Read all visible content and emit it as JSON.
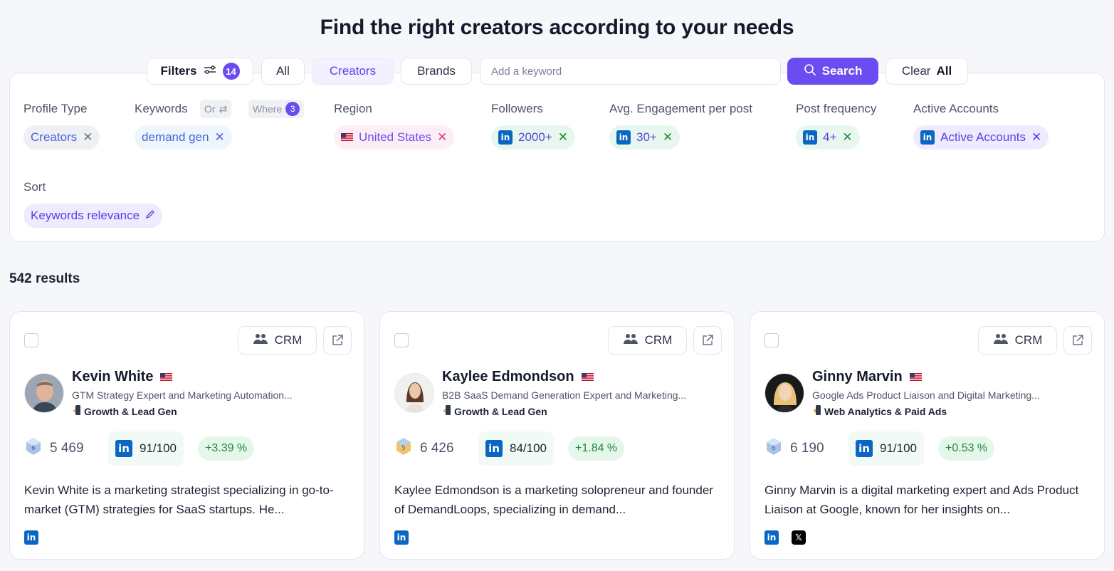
{
  "page": {
    "title": "Find the right creators according to your needs"
  },
  "toolbar": {
    "filters_label": "Filters",
    "filters_count": "14",
    "all_label": "All",
    "creators_label": "Creators",
    "brands_label": "Brands",
    "keyword_placeholder": "Add a keyword",
    "search_label": "Search",
    "clear_label": "Clear",
    "clear_all_label": "All"
  },
  "filters": {
    "profile_type": {
      "label": "Profile Type",
      "chip": "Creators"
    },
    "keywords": {
      "label": "Keywords",
      "or_label": "Or",
      "where_label": "Where",
      "where_count": "3",
      "chip": "demand gen"
    },
    "region": {
      "label": "Region",
      "chip": "United States"
    },
    "followers": {
      "label": "Followers",
      "chip": "2000+"
    },
    "engagement": {
      "label": "Avg. Engagement per post",
      "chip": "30+"
    },
    "post_frequency": {
      "label": "Post frequency",
      "chip": "4+"
    },
    "active_accounts": {
      "label": "Active Accounts",
      "chip": "Active Accounts"
    },
    "sort": {
      "label": "Sort",
      "chip": "Keywords relevance"
    }
  },
  "results": {
    "count_label": "542 results"
  },
  "cards": [
    {
      "crm_label": "CRM",
      "name": "Kevin White",
      "subtitle": "GTM Strategy Expert and Marketing Automation...",
      "category": "Growth & Lead Gen",
      "followers": "5 469",
      "score": "91/100",
      "growth": "+3.39 %",
      "description": "Kevin White is a marketing strategist specializing in go-to-market (GTM) strategies for SaaS startups. He...",
      "socials": [
        "linkedin-icon"
      ]
    },
    {
      "crm_label": "CRM",
      "name": "Kaylee Edmondson",
      "subtitle": "B2B SaaS Demand Generation Expert and Marketing...",
      "category": "Growth & Lead Gen",
      "followers": "6 426",
      "score": "84/100",
      "growth": "+1.84 %",
      "description": "Kaylee Edmondson is a marketing solopreneur and founder of DemandLoops, specializing in demand...",
      "socials": [
        "linkedin-icon"
      ]
    },
    {
      "crm_label": "CRM",
      "name": "Ginny Marvin",
      "subtitle": "Google Ads Product Liaison and Digital Marketing...",
      "category": "Web Analytics & Paid Ads",
      "followers": "6 190",
      "score": "91/100",
      "growth": "+0.53 %",
      "description": "Ginny Marvin is a digital marketing expert and Ads Product Liaison at Google, known for her insights on...",
      "socials": [
        "linkedin-icon",
        "x-icon"
      ]
    }
  ],
  "colors": {
    "accent": "#6a4cf0",
    "linkedin": "#0a66c2",
    "growth_bg": "#e5f7ea",
    "growth_text": "#1b8a3a"
  }
}
